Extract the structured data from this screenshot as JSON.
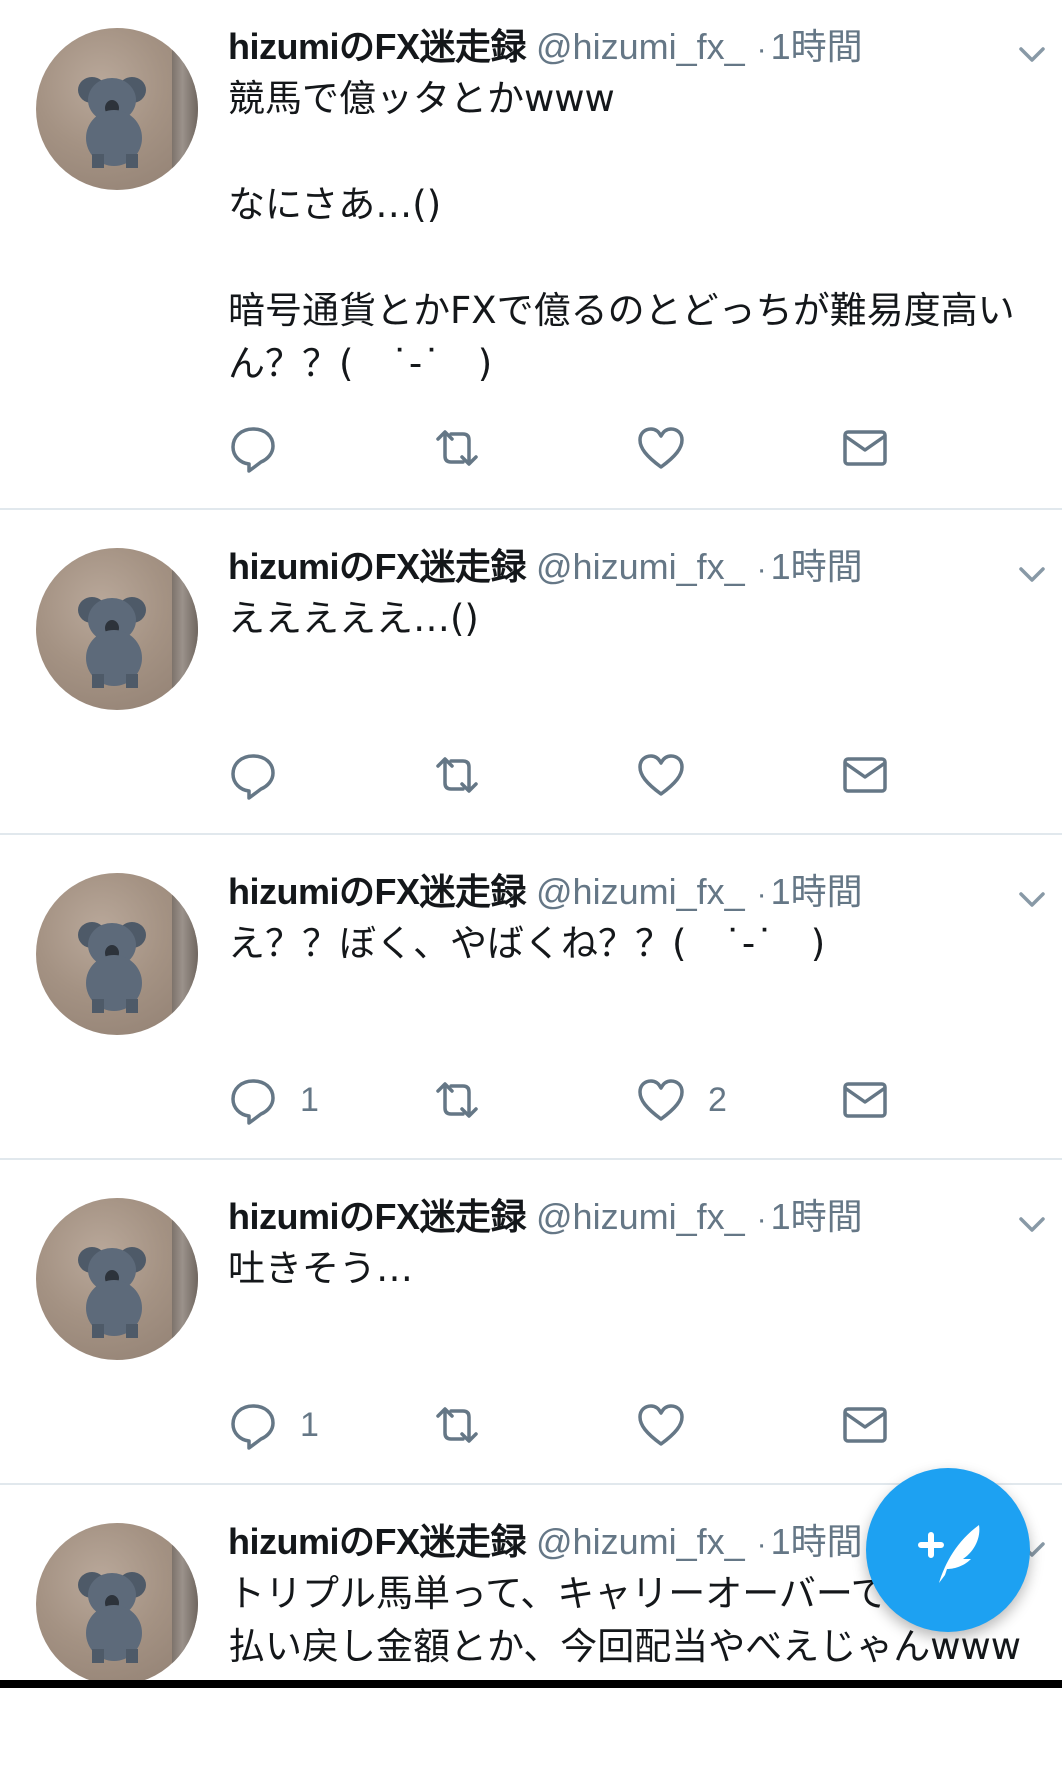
{
  "tweets": [
    {
      "name": "hizumiのFX迷走録",
      "handle": "@hizumi_fx_",
      "separator": "·",
      "time": "1時間",
      "text": "競馬で億ッタとかwww\n\nなにさあ…()\n\n暗号通貨とかFXで億るのとどっちが難易度高いん？？(　˙-˙　)",
      "reply_count": "",
      "like_count": ""
    },
    {
      "name": "hizumiのFX迷走録",
      "handle": "@hizumi_fx_",
      "separator": "·",
      "time": "1時間",
      "text": "えええええ…()",
      "reply_count": "",
      "like_count": ""
    },
    {
      "name": "hizumiのFX迷走録",
      "handle": "@hizumi_fx_",
      "separator": "·",
      "time": "1時間",
      "text": "え？？ぼく、やばくね？？(　˙-˙　)",
      "reply_count": "1",
      "like_count": "2"
    },
    {
      "name": "hizumiのFX迷走録",
      "handle": "@hizumi_fx_",
      "separator": "·",
      "time": "1時間",
      "text": "吐きそう…",
      "reply_count": "1",
      "like_count": ""
    },
    {
      "name": "hizumiのFX迷走録",
      "handle": "@hizumi_fx_",
      "separator": "·",
      "time": "1時間",
      "text": "トリプル馬単って、キャリーオーバーで\n払い戻し金額とか、今回配当やべえじゃんwww",
      "reply_count": "",
      "like_count": ""
    }
  ],
  "icons": {
    "reply": "reply-icon",
    "retweet": "retweet-icon",
    "like": "like-icon",
    "dm": "envelope-icon",
    "menu": "chevron-down-icon",
    "compose": "compose-tweet-icon"
  },
  "colors": {
    "accent": "#1da1f2",
    "secondary_text": "#657786",
    "primary_text": "#14171a",
    "divider": "#e1e8ed"
  }
}
